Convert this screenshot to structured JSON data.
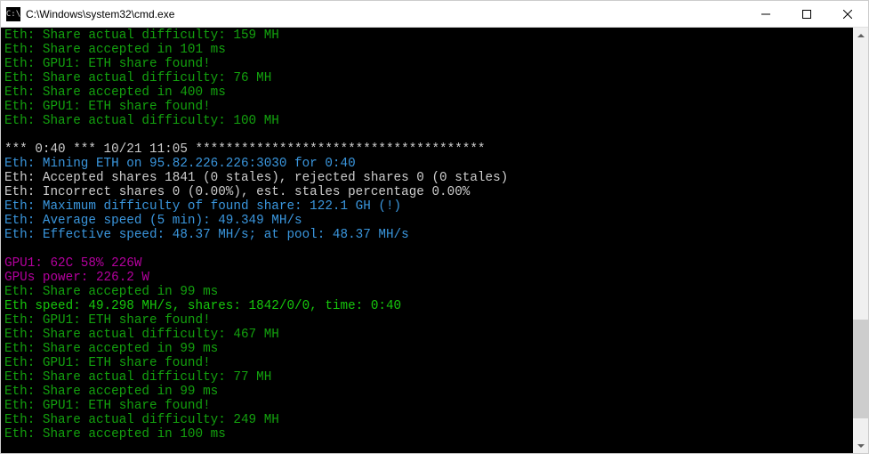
{
  "title": "C:\\Windows\\system32\\cmd.exe",
  "lines": [
    {
      "cls": "green",
      "t": "Eth: Share actual difficulty: 159 MH"
    },
    {
      "cls": "green",
      "t": "Eth: Share accepted in 101 ms"
    },
    {
      "cls": "green",
      "t": "Eth: GPU1: ETH share found!"
    },
    {
      "cls": "green",
      "t": "Eth: Share actual difficulty: 76 MH"
    },
    {
      "cls": "green",
      "t": "Eth: Share accepted in 400 ms"
    },
    {
      "cls": "green",
      "t": "Eth: GPU1: ETH share found!"
    },
    {
      "cls": "green",
      "t": "Eth: Share actual difficulty: 100 MH"
    },
    {
      "cls": "white",
      "t": ""
    },
    {
      "cls": "white",
      "t": "*** 0:40 *** 10/21 11:05 **************************************"
    },
    {
      "cls": "cyan",
      "t": "Eth: Mining ETH on 95.82.226.226:3030 for 0:40"
    },
    {
      "cls": "white",
      "t": "Eth: Accepted shares 1841 (0 stales), rejected shares 0 (0 stales)"
    },
    {
      "cls": "white",
      "t": "Eth: Incorrect shares 0 (0.00%), est. stales percentage 0.00%"
    },
    {
      "cls": "cyan",
      "t": "Eth: Maximum difficulty of found share: 122.1 GH (!)"
    },
    {
      "cls": "cyan",
      "t": "Eth: Average speed (5 min): 49.349 MH/s"
    },
    {
      "cls": "cyan",
      "t": "Eth: Effective speed: 48.37 MH/s; at pool: 48.37 MH/s"
    },
    {
      "cls": "white",
      "t": ""
    },
    {
      "cls": "magenta",
      "t": "GPU1: 62C 58% 226W"
    },
    {
      "cls": "magenta",
      "t": "GPUs power: 226.2 W"
    },
    {
      "cls": "green",
      "t": "Eth: Share accepted in 99 ms"
    },
    {
      "cls": "lgreen",
      "t": "Eth speed: 49.298 MH/s, shares: 1842/0/0, time: 0:40"
    },
    {
      "cls": "green",
      "t": "Eth: GPU1: ETH share found!"
    },
    {
      "cls": "green",
      "t": "Eth: Share actual difficulty: 467 MH"
    },
    {
      "cls": "green",
      "t": "Eth: Share accepted in 99 ms"
    },
    {
      "cls": "green",
      "t": "Eth: GPU1: ETH share found!"
    },
    {
      "cls": "green",
      "t": "Eth: Share actual difficulty: 77 MH"
    },
    {
      "cls": "green",
      "t": "Eth: Share accepted in 99 ms"
    },
    {
      "cls": "green",
      "t": "Eth: GPU1: ETH share found!"
    },
    {
      "cls": "green",
      "t": "Eth: Share actual difficulty: 249 MH"
    },
    {
      "cls": "green",
      "t": "Eth: Share accepted in 100 ms"
    }
  ]
}
